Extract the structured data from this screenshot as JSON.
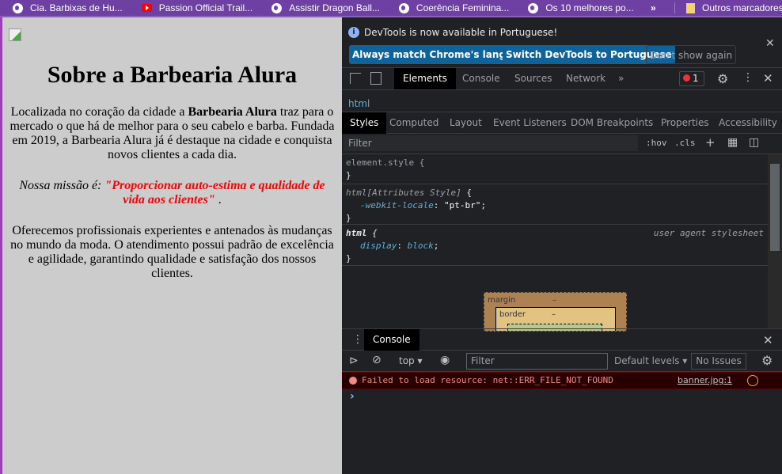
{
  "bookmarks": {
    "items": [
      {
        "label": "Cia. Barbixas de Hu...",
        "icon": "globe-icon"
      },
      {
        "label": "Passion Official Trail...",
        "icon": "youtube-icon"
      },
      {
        "label": "Assistir Dragon Ball...",
        "icon": "globe-icon"
      },
      {
        "label": "Coerência Feminina...",
        "icon": "globe-icon"
      },
      {
        "label": "Os 10 melhores po...",
        "icon": "globe-icon"
      }
    ],
    "more": "»",
    "other": "Outros marcadores"
  },
  "page": {
    "title": "Sobre a Barbearia Alura",
    "p1_a": "Localizada no coração da cidade a ",
    "p1_b": "Barbearia Alura",
    "p1_c": " traz para o mercado o que há de melhor para o seu cabelo e barba. Fundada em 2019, a Barbearia Alura já é destaque na cidade e conquista novos clientes a cada dia.",
    "mission_label": "Nossa missão é: ",
    "mission": "\"Proporcionar auto-estima e qualidade de vida aos clientes\"",
    "mission_end": " .",
    "p3": "Oferecemos profissionais experientes e antenados às mudanças no mundo da moda. O atendimento possui padrão de excelência e agilidade, garantindo qualidade e satisfação dos nossos clientes."
  },
  "devtools": {
    "info": {
      "text": "DevTools is now available in Portuguese!",
      "btn1": "Always match Chrome's language",
      "btn2": "Switch DevTools to Portuguese",
      "btn3": "Don't show again"
    },
    "tabs": [
      "Elements",
      "Console",
      "Sources",
      "Network"
    ],
    "more": "»",
    "error_count": "1",
    "breadcrumb": "html",
    "subtabs": [
      "Styles",
      "Computed",
      "Layout",
      "Event Listeners",
      "DOM Breakpoints",
      "Properties",
      "Accessibility"
    ],
    "filter_placeholder": "Filter",
    "hov": ":hov",
    "cls": ".cls",
    "rules": {
      "r1_sel": "element.style {",
      "close": "}",
      "r2_sel": "html[Attributes Style]",
      "r2_prop": "-webkit-locale",
      "r2_val": "\"pt-br\"",
      "r3_sel": "html",
      "r3_src": "user agent stylesheet",
      "r3_prop": "display",
      "r3_val": "block"
    },
    "boxmodel": {
      "margin": "margin",
      "border": "border",
      "dash": "–"
    },
    "drawer": {
      "tab": "Console",
      "context": "top",
      "filter_placeholder": "Filter",
      "levels": "Default levels",
      "issues": "No Issues"
    },
    "console": {
      "error": "Failed to load resource: net::ERR_FILE_NOT_FOUND",
      "source": "banner.jpg:1",
      "prompt": "›"
    }
  },
  "colors": {
    "bookmarks_bg": "#6f40a3",
    "page_bg": "#cccccc",
    "accent_button": "#0e639c",
    "error": "#f28b82"
  }
}
